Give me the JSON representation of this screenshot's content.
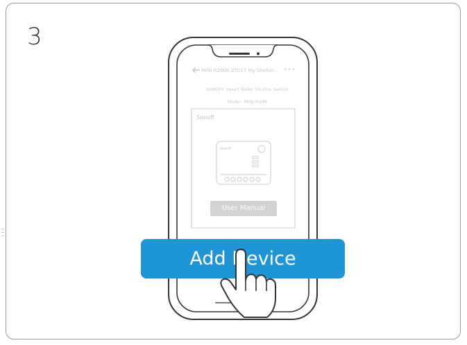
{
  "step": {
    "number": "3"
  },
  "phone": {
    "header_title": "MINI-R2000 ZT017 My Shelter...",
    "menu_dots": "•••",
    "product_name": "SONOFF Smart Roller Shutter Switch",
    "product_model": "Model: MINI-R4/M",
    "brand": "Sonoff",
    "device_brand": "Sonoff"
  },
  "buttons": {
    "user_manual": "User Manual",
    "add_device": "Add Device"
  },
  "colors": {
    "accent": "#1f95d6",
    "outline": "#333333",
    "muted": "#c9c9c9"
  }
}
